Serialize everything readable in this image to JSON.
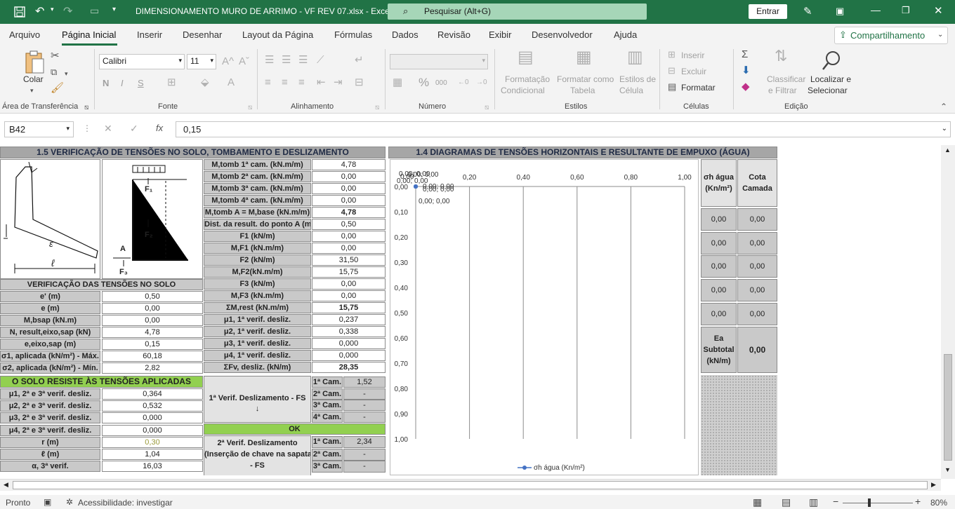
{
  "titlebar": {
    "filename": "DIMENSIONAMENTO MURO DE ARRIMO - VF REV 07.xlsx  -  Excel",
    "search": "Pesquisar (Alt+G)",
    "signin": "Entrar"
  },
  "menu": [
    "Arquivo",
    "Página Inicial",
    "Inserir",
    "Desenhar",
    "Layout da Página",
    "Fórmulas",
    "Dados",
    "Revisão",
    "Exibir",
    "Desenvolvedor",
    "Ajuda"
  ],
  "share": "Compartilhamento",
  "ribbon": {
    "paste": "Colar",
    "font_name": "Calibri",
    "font_size": "11",
    "bold": "N",
    "italic": "I",
    "underline": "S",
    "percent": "%",
    "thousands": "000",
    "cond_format": [
      "Formatação",
      "Condicional"
    ],
    "format_table": [
      "Formatar como",
      "Tabela"
    ],
    "cell_styles": [
      "Estilos de",
      "Célula"
    ],
    "insert": "Inserir",
    "delete": "Excluir",
    "format": "Formatar",
    "sort_filter": [
      "Classificar",
      "e Filtrar"
    ],
    "find_select": [
      "Localizar e",
      "Selecionar"
    ],
    "groups": [
      "Área de Transferência",
      "Fonte",
      "Alinhamento",
      "Número",
      "Estilos",
      "Células",
      "Edição"
    ]
  },
  "formula": {
    "namebox": "B42",
    "value": "0,15"
  },
  "sheet": {
    "h15": "1.5 VERIFICAÇÃO DE TENSÕES NO SOLO, TOMBAMENTO E DESLIZAMENTO",
    "h14": "1.4 DIAGRAMAS DE TENSÕES HORIZONTAIS E RESULTANTE DE EMPUXO (ÁGUA)",
    "img2_labels": [
      "F₁",
      "F₂",
      "A",
      "F₃"
    ],
    "img1_labels": [
      "ε",
      "ℓ"
    ],
    "mid_rows": [
      [
        "M,tomb 1ª cam. (kN.m/m)",
        "4,78",
        0
      ],
      [
        "M,tomb 2ª cam. (kN.m/m)",
        "0,00",
        0
      ],
      [
        "M,tomb 3ª cam. (kN.m/m)",
        "0,00",
        0
      ],
      [
        "M,tomb 4ª cam. (kN.m/m)",
        "0,00",
        0
      ],
      [
        "M,tomb A = M,base (kN.m/m)",
        "4,78",
        1
      ],
      [
        "Dist. da result. do ponto A (m)",
        "0,50",
        0
      ],
      [
        "F1 (kN/m)",
        "0,00",
        0
      ],
      [
        "M,F1 (kN.m/m)",
        "0,00",
        0
      ],
      [
        "F2 (kN/m)",
        "31,50",
        0
      ],
      [
        "M,F2(kN.m/m)",
        "15,75",
        0
      ],
      [
        "F3 (kN/m)",
        "0,00",
        0
      ],
      [
        "M,F3 (kN.m/m)",
        "0,00",
        0
      ],
      [
        "ΣM,rest (kN.m/m)",
        "15,75",
        1
      ],
      [
        "μ1, 1ª verif. desliz.",
        "0,237",
        0
      ],
      [
        "μ2, 1ª verif. desliz.",
        "0,338",
        0
      ],
      [
        "μ3, 1ª verif. desliz.",
        "0,000",
        0
      ],
      [
        "μ4, 1ª verif. desliz.",
        "0,000",
        0
      ],
      [
        "ΣFv, desliz. (kN/m)",
        "28,35",
        1
      ]
    ],
    "soil_header": "VERIFICAÇÃO DAS TENSÕES NO SOLO",
    "soil_rows": [
      [
        "e' (m)",
        "0,50"
      ],
      [
        "e (m)",
        "0,00"
      ],
      [
        "M,bsap (kN.m)",
        "0,00"
      ],
      [
        "N, result,eixo,sap (kN)",
        "4,78"
      ],
      [
        "e,eixo,sap (m)",
        "0,15"
      ],
      [
        "σ1, aplicada (kN/m²) - Máx.",
        "60,18"
      ],
      [
        "σ2, aplicada (kN/m²) - Mín.",
        "2,82"
      ]
    ],
    "soil_ok": "O SOLO RESISTE ÀS TENSÕES APLICADAS",
    "lower_rows": [
      [
        "μ1, 2ª e 3ª verif. desliz.",
        "0,364"
      ],
      [
        "μ2, 2ª e 3ª verif. desliz.",
        "0,532"
      ],
      [
        "μ3, 2ª e 3ª verif. desliz.",
        "0,000"
      ],
      [
        "μ4, 2ª e 3ª verif. desliz.",
        "0,000"
      ],
      [
        "r (m)",
        "0,30"
      ],
      [
        "ℓ (m)",
        "1,04"
      ],
      [
        "α, 3ª verif.",
        "16,03"
      ]
    ],
    "verif1": {
      "label": "1ª Verif. Deslizamento - FS",
      "arrow": "↓",
      "rows": [
        [
          "1ª Cam.",
          "1,52"
        ],
        [
          "2ª Cam.",
          "-"
        ],
        [
          "3ª Cam.",
          "-"
        ],
        [
          "4ª Cam.",
          "-"
        ]
      ],
      "ok": "OK"
    },
    "verif2": {
      "label": [
        "2ª Verif. Deslizamento",
        "(Inserção de chave na sapata)",
        "- FS"
      ],
      "rows": [
        [
          "1ª Cam.",
          "2,34"
        ],
        [
          "2ª Cam.",
          "-"
        ],
        [
          "3ª Cam.",
          "-"
        ]
      ]
    },
    "water_table": {
      "col1": [
        "σh água",
        "(Kn/m²)"
      ],
      "col2": [
        "Cota",
        "Camada"
      ],
      "rows": [
        [
          "0,00",
          "0,00"
        ],
        [
          "0,00",
          "0,00"
        ],
        [
          "0,00",
          "0,00"
        ],
        [
          "0,00",
          "0,00"
        ],
        [
          "0,00",
          "0,00"
        ]
      ],
      "ea_label": [
        "Ea",
        "Subtotal",
        "(kN/m)"
      ],
      "ea_value": "0,00"
    }
  },
  "chart_data": {
    "type": "scatter",
    "series": [
      {
        "name": "σh água (Kn/m²)",
        "x": [
          0,
          0,
          0,
          0,
          0,
          0
        ],
        "y": [
          0,
          0,
          0,
          0,
          0,
          0
        ]
      }
    ],
    "data_labels": [
      "0,00; 0,00",
      "0,00; 0,00",
      "0,00; 0,00",
      "0,00; 0,00",
      "0,00; 0,00",
      "0,00; 0,00"
    ],
    "x_ticks": [
      "0,00",
      "0,20",
      "0,40",
      "0,60",
      "0,80",
      "1,00"
    ],
    "y_ticks": [
      "0,00",
      "0,10",
      "0,20",
      "0,30",
      "0,40",
      "0,50",
      "0,60",
      "0,70",
      "0,80",
      "0,90",
      "1,00"
    ],
    "xlim": [
      0,
      1
    ],
    "ylim": [
      0,
      1
    ],
    "y_reversed": true,
    "x_axis_position": "top",
    "legend": "bottom",
    "grid": "vertical",
    "color": "#4472c4"
  },
  "status": {
    "ready": "Pronto",
    "accessibility": "Acessibilidade: investigar",
    "zoom": "80%"
  }
}
